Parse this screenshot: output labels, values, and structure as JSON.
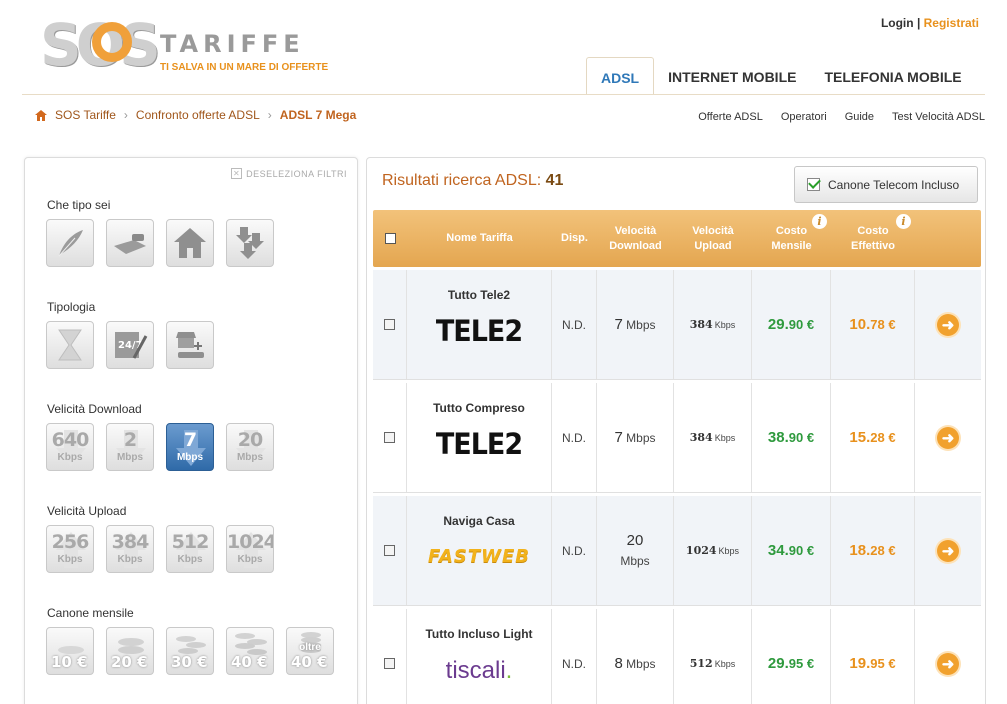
{
  "header": {
    "logo_sos": "SOS",
    "logo_tariffe": "TARIFFE",
    "logo_tagline": "TI SALVA IN UN MARE DI OFFERTE",
    "login": "Login",
    "separator": "|",
    "register": "Registrati",
    "tabs": [
      {
        "label": "ADSL",
        "active": true
      },
      {
        "label": "INTERNET MOBILE",
        "active": false
      },
      {
        "label": "TELEFONIA MOBILE",
        "active": false
      }
    ]
  },
  "breadcrumb": {
    "items": [
      "SOS Tariffe",
      "Confronto offerte ADSL",
      "ADSL 7 Mega"
    ],
    "separator": "›"
  },
  "sub_nav": [
    "Offerte ADSL",
    "Operatori",
    "Guide",
    "Test Velocità ADSL"
  ],
  "sidebar": {
    "deselect_label": "DESELEZIONA FILTRI",
    "sections": [
      {
        "title": "Che tipo sei",
        "icons": [
          "feather-icon",
          "laptop-coffee-icon",
          "house-icon",
          "download-boxes-icon"
        ]
      },
      {
        "title": "Tipologia",
        "icons": [
          "hourglass-icon",
          "always-on-24-7-icon",
          "phone-modem-icon"
        ]
      },
      {
        "title": "Velicità Download",
        "options": [
          {
            "value": "640",
            "unit": "Kbps",
            "selected": false
          },
          {
            "value": "2",
            "unit": "Mbps",
            "selected": false
          },
          {
            "value": "7",
            "unit": "Mbps",
            "selected": true
          },
          {
            "value": "20",
            "unit": "Mbps",
            "selected": false
          }
        ]
      },
      {
        "title": "Velicità Upload",
        "options": [
          {
            "value": "256",
            "unit": "Kbps"
          },
          {
            "value": "384",
            "unit": "Kbps"
          },
          {
            "value": "512",
            "unit": "Kbps"
          },
          {
            "value": "1024",
            "unit": "Kbps"
          }
        ]
      },
      {
        "title": "Canone mensile",
        "options": [
          {
            "prefix": "",
            "value": "10 €"
          },
          {
            "prefix": "",
            "value": "20 €"
          },
          {
            "prefix": "",
            "value": "30 €"
          },
          {
            "prefix": "",
            "value": "40 €"
          },
          {
            "prefix": "oltre",
            "value": "40 €"
          }
        ]
      }
    ]
  },
  "results": {
    "title": "Risultati ricerca ADSL:",
    "count": "41",
    "canone_label": "Canone Telecom Incluso",
    "canone_checked": true,
    "columns": [
      "Nome Tariffa",
      "Disp.",
      "Velocità Download",
      "Velocità Upload",
      "Costo Mensile",
      "Costo Effettivo"
    ],
    "rows": [
      {
        "name": "Tutto Tele2",
        "logo": "TELE2",
        "logo_type": "tele2",
        "disp": "N.D.",
        "down_val": "7",
        "down_unit": "Mbps",
        "up_val": "384",
        "up_unit": "Kbps",
        "monthly_int": "29.",
        "monthly_dec": "90 €",
        "effective_int": "10.",
        "effective_dec": "78 €"
      },
      {
        "name": "Tutto Compreso",
        "logo": "TELE2",
        "logo_type": "tele2",
        "disp": "N.D.",
        "down_val": "7",
        "down_unit": "Mbps",
        "up_val": "384",
        "up_unit": "Kbps",
        "monthly_int": "38.",
        "monthly_dec": "90 €",
        "effective_int": "15.",
        "effective_dec": "28 €"
      },
      {
        "name": "Naviga Casa",
        "logo": "FASTWEB",
        "logo_type": "fastweb",
        "disp": "N.D.",
        "down_val": "20",
        "down_unit": "Mbps",
        "up_val": "1024",
        "up_unit": "Kbps",
        "monthly_int": "34.",
        "monthly_dec": "90 €",
        "effective_int": "18.",
        "effective_dec": "28 €"
      },
      {
        "name": "Tutto Incluso Light",
        "logo": "tiscali",
        "logo_dot": ".",
        "logo_type": "tiscali",
        "disp": "N.D.",
        "down_val": "8",
        "down_unit": "Mbps",
        "up_val": "512",
        "up_unit": "Kbps",
        "monthly_int": "29.",
        "monthly_dec": "95 €",
        "effective_int": "19.",
        "effective_dec": "95 €"
      }
    ]
  },
  "colors": {
    "orange": "#e8911d",
    "blue_active": "#2f78b8",
    "green_price": "#2f9a3e",
    "header_orange": "#e4a650"
  }
}
